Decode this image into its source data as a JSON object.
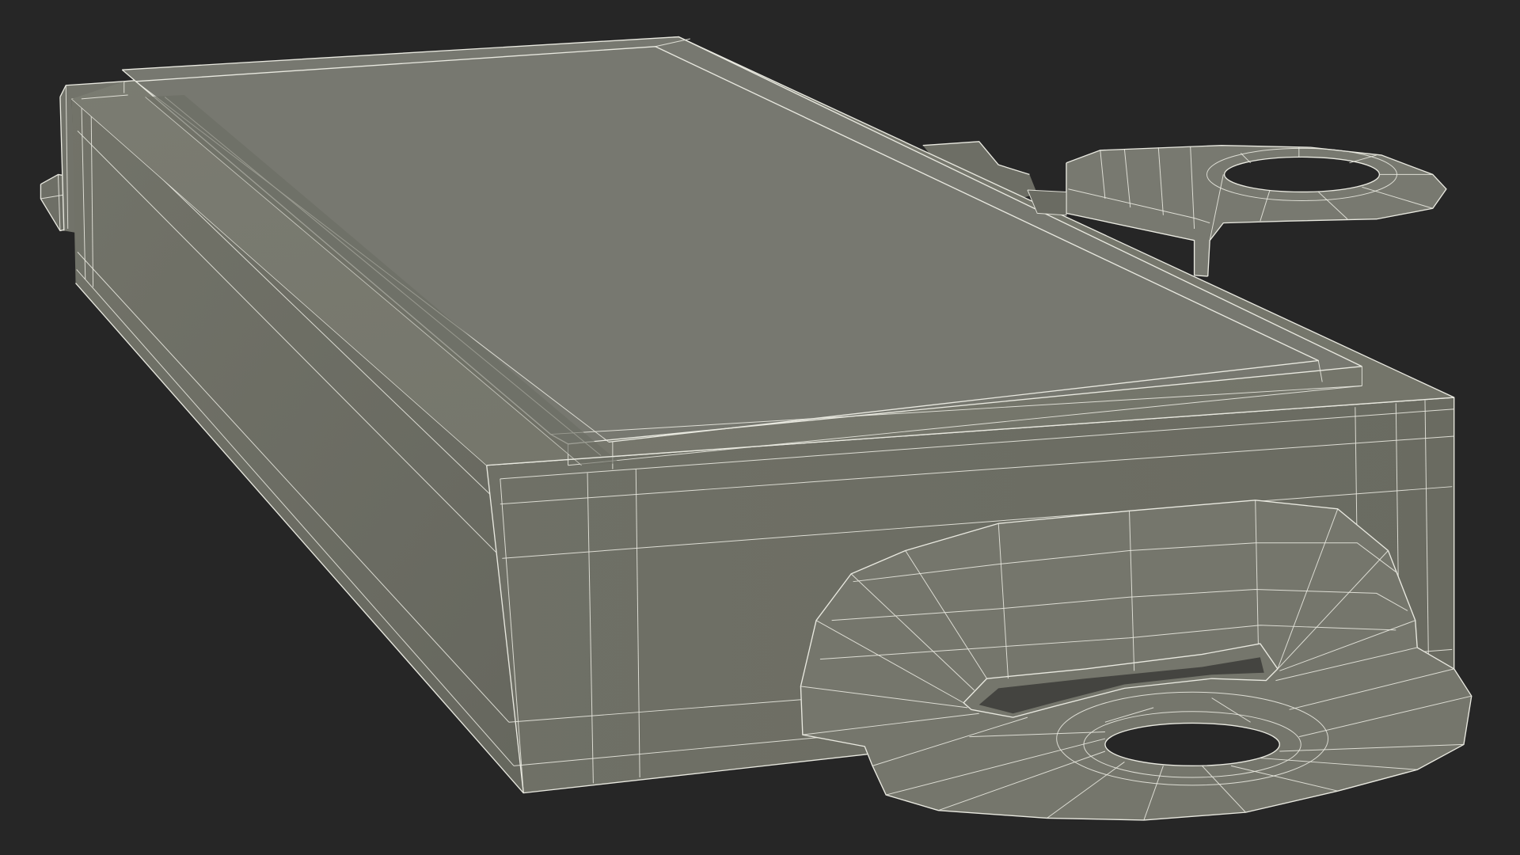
{
  "scene": {
    "background_color": "#262626",
    "model_color": "#7a7b71",
    "wireframe_color": "#e9e9e0"
  }
}
